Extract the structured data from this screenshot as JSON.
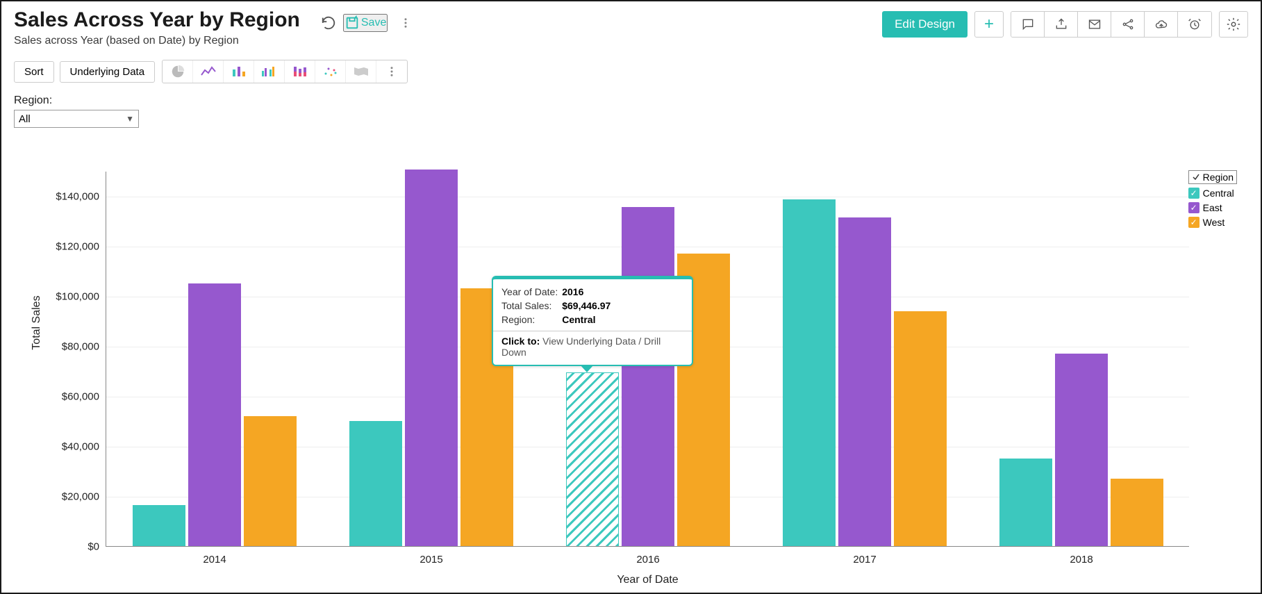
{
  "header": {
    "title": "Sales Across Year by Region",
    "subtitle": "Sales across Year (based on Date) by Region",
    "save_label": "Save",
    "edit_label": "Edit Design"
  },
  "row2": {
    "sort_label": "Sort",
    "underlying_label": "Underlying Data"
  },
  "filter": {
    "label": "Region:",
    "value": "All"
  },
  "legend": {
    "title": "Region",
    "items": [
      {
        "key": "central",
        "label": "Central",
        "color": "#3CC8BE"
      },
      {
        "key": "east",
        "label": "East",
        "color": "#9658CE"
      },
      {
        "key": "west",
        "label": "West",
        "color": "#F5A623"
      }
    ]
  },
  "tooltip": {
    "rows": [
      {
        "k": "Year of Date:",
        "v": "2016"
      },
      {
        "k": "Total Sales:",
        "v": "$69,446.97"
      },
      {
        "k": "Region:",
        "v": "Central"
      }
    ],
    "click_label": "Click to:",
    "click_action": "View Underlying Data / Drill Down"
  },
  "chart_data": {
    "type": "bar",
    "title": "Sales Across Year by Region",
    "xlabel": "Year of Date",
    "ylabel": "Total Sales",
    "ylim": [
      0,
      150000
    ],
    "yticks": [
      0,
      20000,
      40000,
      60000,
      80000,
      100000,
      120000,
      140000
    ],
    "ytick_labels": [
      "$0",
      "$20,000",
      "$40,000",
      "$60,000",
      "$80,000",
      "$100,000",
      "$120,000",
      "$140,000"
    ],
    "categories": [
      "2014",
      "2015",
      "2016",
      "2017",
      "2018"
    ],
    "series": [
      {
        "name": "Central",
        "key": "central",
        "values": [
          16500,
          50000,
          69446.97,
          138500,
          35000
        ]
      },
      {
        "name": "East",
        "key": "east",
        "values": [
          105000,
          150500,
          135500,
          131500,
          77000
        ]
      },
      {
        "name": "West",
        "key": "west",
        "values": [
          52000,
          103000,
          117000,
          94000,
          27000
        ]
      }
    ],
    "highlight": {
      "category": "2016",
      "series": "central"
    }
  }
}
